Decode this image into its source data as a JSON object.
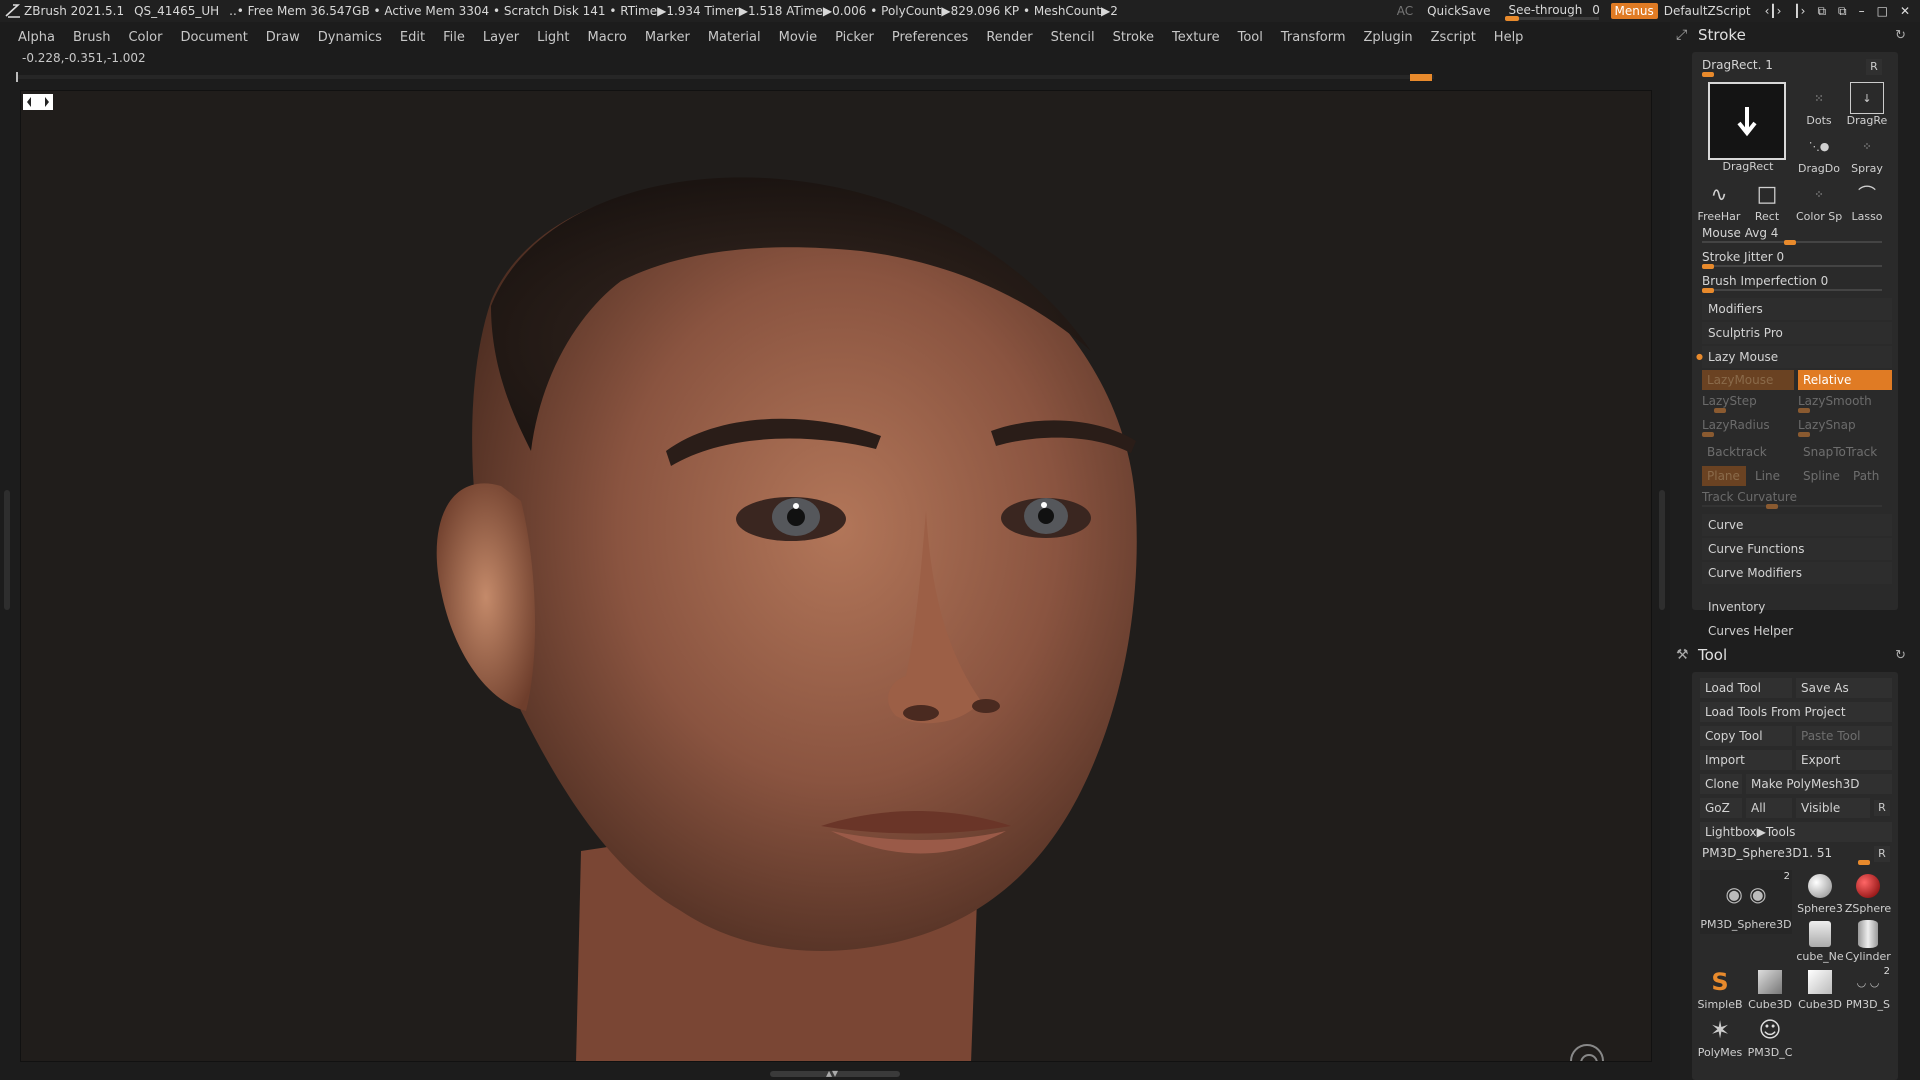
{
  "titlebar": {
    "app": "ZBrush 2021.5.1",
    "file": "QS_41465_UH",
    "stats": "..• Free Mem 36.547GB • Active Mem 3304 • Scratch Disk 141 •  RTime▶1.934 Timer▶1.518 ATime▶0.006 • PolyCount▶829.096 KP  • MeshCount▶2",
    "ac": "AC",
    "quicksave": "QuickSave",
    "see_through": "See-through",
    "see_through_value": "0",
    "menus": "Menus",
    "zscript": "DefaultZScript",
    "accent": "#e07b24"
  },
  "menubar": [
    "Alpha",
    "Brush",
    "Color",
    "Document",
    "Draw",
    "Dynamics",
    "Edit",
    "File",
    "Layer",
    "Light",
    "Macro",
    "Marker",
    "Material",
    "Movie",
    "Picker",
    "Preferences",
    "Render",
    "Stencil",
    "Stroke",
    "Texture",
    "Tool",
    "Transform",
    "Zplugin",
    "Zscript",
    "Help"
  ],
  "coords": "-0.228,-0.351,-1.002",
  "stroke": {
    "title": "Stroke",
    "current": "DragRect. 1",
    "r": "R",
    "thumbs": {
      "main": "DragRect",
      "dots": "Dots",
      "dragrect_small": "DragRe",
      "dragdot": "DragDo",
      "spray": "Spray",
      "freehand": "FreeHar",
      "rect": "Rect",
      "colorspray": "Color Sp",
      "lasso": "Lasso"
    },
    "sliders": {
      "mouse_avg": "Mouse Avg 4",
      "mouse_avg_value": 4,
      "stroke_jitter": "Stroke Jitter 0",
      "brush_imperfection": "Brush Imperfection 0"
    },
    "subpalettes": [
      "Modifiers",
      "Sculptris Pro",
      "Lazy Mouse"
    ],
    "lazy": {
      "lazymouse": "LazyMouse",
      "relative": "Relative",
      "lazystep": "LazyStep",
      "lazysmooth": "LazySmooth",
      "lazyradius": "LazyRadius",
      "lazysnap": "LazySnap",
      "backtrack": "Backtrack",
      "snaptotrack": "SnapToTrack",
      "plane": "Plane",
      "line": "Line",
      "spline": "Spline",
      "path": "Path",
      "track_curvature": "Track Curvature"
    },
    "curve": [
      "Curve",
      "Curve Functions",
      "Curve Modifiers"
    ]
  },
  "plugins": [
    "Inventory",
    "Curves Helper"
  ],
  "tool": {
    "title": "Tool",
    "load_tool": "Load Tool",
    "save_as": "Save As",
    "load_from_project": "Load Tools From Project",
    "copy_tool": "Copy Tool",
    "paste_tool": "Paste Tool",
    "import": "Import",
    "export": "Export",
    "clone": "Clone",
    "make_polymesh": "Make PolyMesh3D",
    "goz": "GoZ",
    "all": "All",
    "visible": "Visible",
    "r": "R",
    "lightbox": "Lightbox▶Tools",
    "current": "PM3D_Sphere3D1. 51",
    "thumbs": {
      "pm3d_big": "PM3D_Sphere3D",
      "pm3d_big_count": "2",
      "sphere": "Sphere3",
      "zsphere": "ZSphere",
      "cube_ne": "cube_Ne",
      "cylinder": "Cylinder",
      "simpleb": "SimpleB",
      "cube3d_a": "Cube3D",
      "cube3d_b": "Cube3D",
      "pm3d_s": "PM3D_S",
      "pm3d_s_count": "2",
      "polymesh": "PolyMes",
      "pm3d_c": "PM3D_C"
    }
  }
}
